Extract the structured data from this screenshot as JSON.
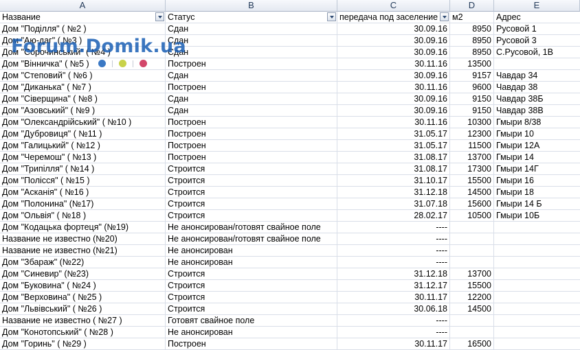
{
  "columns": [
    "A",
    "B",
    "C",
    "D",
    "E"
  ],
  "headers": [
    "Название",
    "Статус",
    "передача под заселение",
    "м2",
    "Адрес"
  ],
  "rows": [
    [
      "Дом \"Поділля\" ( №2 )",
      "Сдан",
      "30.09.16",
      "8950",
      "Русовой 1"
    ],
    [
      "Дом \"Аю-даг\" ( №3 )",
      "Сдан",
      "30.09.16",
      "8950",
      "Русовой 3"
    ],
    [
      "Дом \"Сорочинський\" ( №4 )",
      "Сдан",
      "30.09.16",
      "8950",
      "С.Русовой, 1В"
    ],
    [
      "Дом \"Вінничка\" ( №5 )",
      "Построен",
      "30.11.16",
      "13500",
      ""
    ],
    [
      "Дом \"Степовий\" ( №6 )",
      "Сдан",
      "30.09.16",
      "9157",
      "Чавдар 34"
    ],
    [
      "Дом \"Диканька\" ( №7 )",
      "Построен",
      "30.11.16",
      "9600",
      "Чавдар 38"
    ],
    [
      "Дом \"Сіверщина\" ( №8 )",
      "Сдан",
      "30.09.16",
      "9150",
      "Чавдар 38Б"
    ],
    [
      "Дом \"Азовський\" ( №9 )",
      "Сдан",
      "30.09.16",
      "9150",
      "Чавдар 38В"
    ],
    [
      "Дом \"Олександрійський\" ( №10 )",
      "Построен",
      "30.11.16",
      "10300",
      "Гмыри 8/38"
    ],
    [
      "Дом \"Дубровиця\" ( №11 )",
      "Построен",
      "31.05.17",
      "12300",
      "Гмыри 10"
    ],
    [
      "Дом \"Галицький\" ( №12 )",
      "Построен",
      "31.05.17",
      "11500",
      "Гмыри 12А"
    ],
    [
      "Дом \"Черемош\" ( №13 )",
      "Построен",
      "31.08.17",
      "13700",
      "Гмыри 14"
    ],
    [
      "Дом \"Трипілля\" ( №14 )",
      "Строится",
      "31.08.17",
      "17300",
      "Гмыри 14Г"
    ],
    [
      "Дом \"Полісся\" ( №15 )",
      "Строится",
      "31.10.17",
      "15500",
      "Гмыри 16"
    ],
    [
      "Дом \"Асканія\" ( №16 )",
      "Строится",
      "31.12.18",
      "14500",
      "Гмыри 18"
    ],
    [
      "Дом \"Полонина\" (№17)",
      "Строится",
      "31.07.18",
      "15600",
      "Гмыри 14 Б"
    ],
    [
      "Дом \"Ольвія\" ( №18 )",
      "Строится",
      "28.02.17",
      "10500",
      "Гмыри 10Б"
    ],
    [
      "Дом \"Кодацька фортеця\" (№19)",
      "Не анонсирован/готовят свайное поле",
      "----",
      "",
      ""
    ],
    [
      "Название не известно (№20)",
      "Не анонсирован/готовят свайное поле",
      "----",
      "",
      ""
    ],
    [
      "Название не известно  (№21)",
      "Не анонсирован",
      "----",
      "",
      ""
    ],
    [
      "Дом \"Збараж\" (№22)",
      "Не анонсирован",
      "----",
      "",
      ""
    ],
    [
      "Дом \"Синевир\" (№23)",
      "Строится",
      "31.12.18",
      "13700",
      ""
    ],
    [
      "Дом \"Буковина\" ( №24 )",
      "Строится",
      "31.12.17",
      "15500",
      ""
    ],
    [
      "Дом \"Верховина\" ( №25 )",
      "Строится",
      "30.11.17",
      "12200",
      ""
    ],
    [
      "Дом \"Львівський\" ( №26 )",
      "Строится",
      "30.06.18",
      "14500",
      ""
    ],
    [
      "Название не известно ( №27 )",
      "Готовят свайное поле",
      "----",
      "",
      ""
    ],
    [
      "Дом \"Конотопський\" ( №28 )",
      "Не анонсирован",
      "----",
      "",
      ""
    ],
    [
      "Дом \"Горинь\" ( №29 )",
      "Построен",
      "30.11.17",
      "16500",
      ""
    ]
  ],
  "watermark": "Forum.Domik.ua",
  "watermark_dots": [
    "#3a78c4",
    "#c8d24a",
    "#d2466a"
  ]
}
